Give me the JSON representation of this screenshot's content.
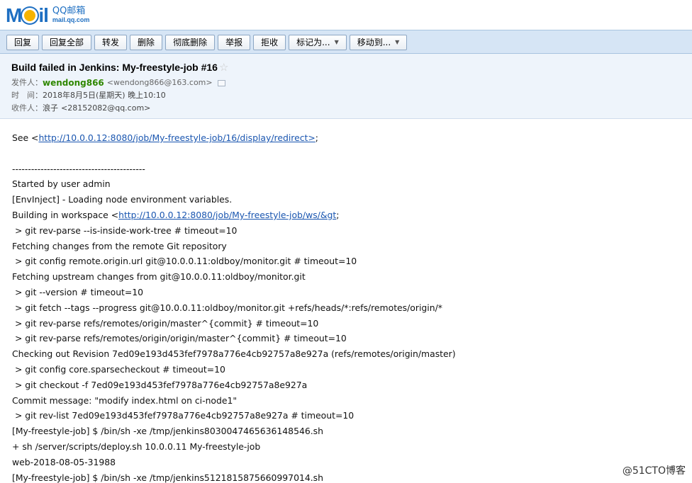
{
  "logo": {
    "word": "M",
    "word_tail": "il",
    "cn": "QQ邮箱",
    "url": "mail.qq.com"
  },
  "toolbar": {
    "reply": "回复",
    "reply_all": "回复全部",
    "forward": "转发",
    "delete": "删除",
    "delete_permanently": "彻底删除",
    "report": "举报",
    "reject": "拒收",
    "mark_as": "标记为...",
    "move_to": "移动到..."
  },
  "header": {
    "subject": "Build failed in Jenkins: My-freestyle-job #16",
    "from_label": "发件人：",
    "from_name": "wendong866",
    "from_email": "<wendong866@163.com>",
    "time_label": "时　间：",
    "time_value": "2018年8月5日(星期天) 晚上10:10",
    "to_label": "收件人：",
    "to_name": "浪子",
    "to_email": "<28152082@qq.com>"
  },
  "body": {
    "see_prefix": "See <",
    "see_link": "http://10.0.0.12:8080/job/My-freestyle-job/16/display/redirect>",
    "see_suffix": ";",
    "blank": "",
    "separator": "------------------------------------------",
    "l1": "Started by user admin",
    "l2": "[EnvInject] - Loading node environment variables.",
    "l3_prefix": "Building in workspace <",
    "l3_link": "http://10.0.0.12:8080/job/My-freestyle-job/ws/&gt",
    "l3_suffix": ";",
    "l4": " > git rev-parse --is-inside-work-tree # timeout=10",
    "l5": "Fetching changes from the remote Git repository",
    "l6": " > git config remote.origin.url git@10.0.0.11:oldboy/monitor.git # timeout=10",
    "l7": "Fetching upstream changes from git@10.0.0.11:oldboy/monitor.git",
    "l8": " > git --version # timeout=10",
    "l9": " > git fetch --tags --progress git@10.0.0.11:oldboy/monitor.git +refs/heads/*:refs/remotes/origin/*",
    "l10": " > git rev-parse refs/remotes/origin/master^{commit} # timeout=10",
    "l11": " > git rev-parse refs/remotes/origin/origin/master^{commit} # timeout=10",
    "l12": "Checking out Revision 7ed09e193d453fef7978a776e4cb92757a8e927a (refs/remotes/origin/master)",
    "l13": " > git config core.sparsecheckout # timeout=10",
    "l14": " > git checkout -f 7ed09e193d453fef7978a776e4cb92757a8e927a",
    "l15": "Commit message: \"modify index.html on ci-node1\"",
    "l16": " > git rev-list 7ed09e193d453fef7978a776e4cb92757a8e927a # timeout=10",
    "l17": "[My-freestyle-job] $ /bin/sh -xe /tmp/jenkins8030047465636148546.sh",
    "l18": "+ sh /server/scripts/deploy.sh 10.0.0.11 My-freestyle-job",
    "l19": "web-2018-08-05-31988",
    "l20": "[My-freestyle-job] $ /bin/sh -xe /tmp/jenkins5121815875660997014.sh"
  },
  "watermark": "@51CTO博客",
  "icons": {
    "star": "star-icon",
    "vcard": "contact-card-icon",
    "caret": "caret-down-icon"
  },
  "colors": {
    "toolbar_bg": "#d6e5f5",
    "header_bg": "#eef4fb",
    "sender": "#2f8700",
    "link": "#1a56b0",
    "logo_blue": "#1e6fc2"
  }
}
